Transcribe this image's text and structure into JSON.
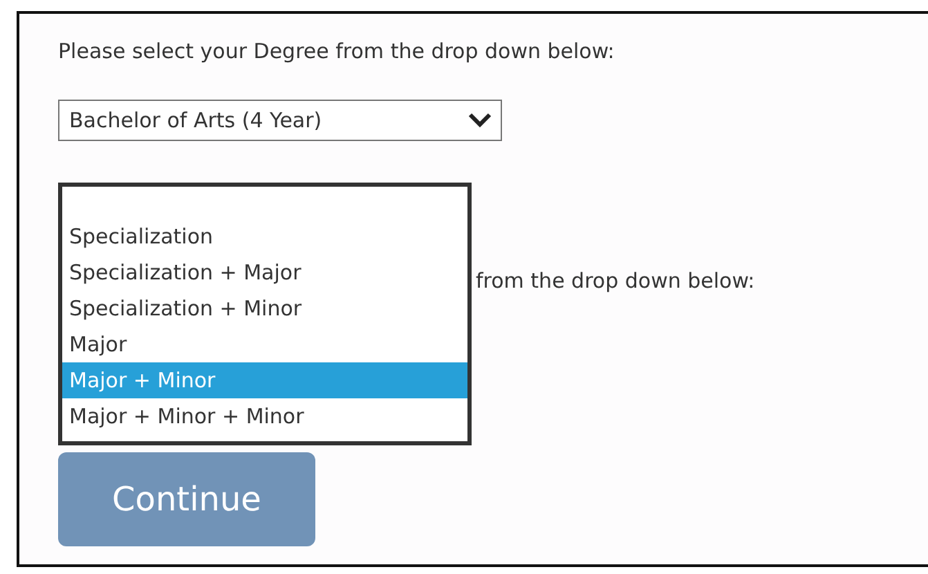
{
  "degree_prompt": "Please select your Degree from the drop down below:",
  "degree_select": {
    "value": "Bachelor of Arts (4 Year)"
  },
  "program_list": {
    "options": [
      {
        "label": "Specialization",
        "selected": false
      },
      {
        "label": "Specialization + Major",
        "selected": false
      },
      {
        "label": "Specialization + Minor",
        "selected": false
      },
      {
        "label": "Major",
        "selected": false
      },
      {
        "label": "Major + Minor",
        "selected": true
      },
      {
        "label": "Major + Minor + Minor",
        "selected": false
      }
    ]
  },
  "program_prompt": "from the drop down below:",
  "continue_button": {
    "label": "Continue",
    "disabled": true
  }
}
